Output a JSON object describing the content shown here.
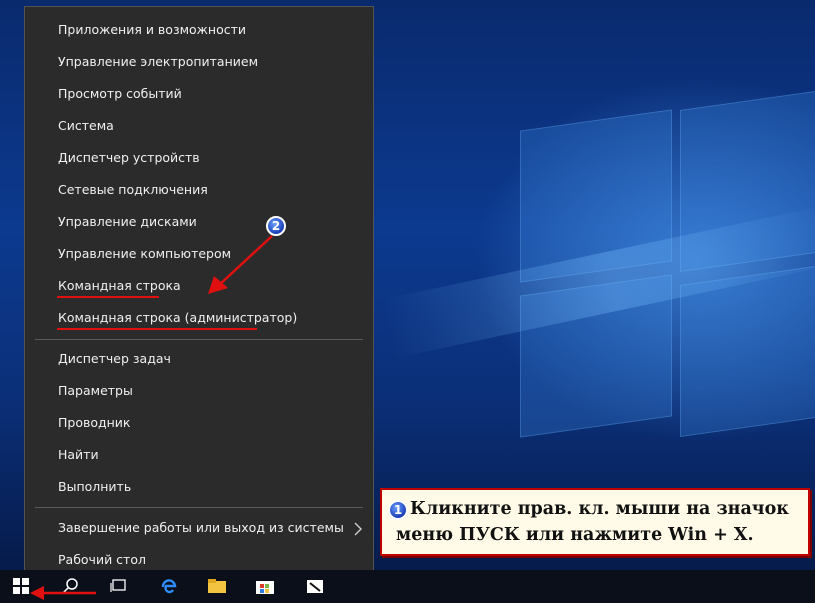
{
  "menu": {
    "items": [
      {
        "label": "Приложения и возможности"
      },
      {
        "label": "Управление электропитанием"
      },
      {
        "label": "Просмотр событий"
      },
      {
        "label": "Система"
      },
      {
        "label": "Диспетчер устройств"
      },
      {
        "label": "Сетевые подключения"
      },
      {
        "label": "Управление дисками"
      },
      {
        "label": "Управление компьютером"
      },
      {
        "label": "Командная строка"
      },
      {
        "label": "Командная строка (администратор)"
      },
      {
        "label": "Диспетчер задач"
      },
      {
        "label": "Параметры"
      },
      {
        "label": "Проводник"
      },
      {
        "label": "Найти"
      },
      {
        "label": "Выполнить"
      },
      {
        "label": "Завершение работы или выход из системы"
      },
      {
        "label": "Рабочий стол"
      }
    ],
    "submenu_icon": "chevron-right-icon"
  },
  "annotations": {
    "badge_1": "1",
    "badge_2": "2",
    "callout_line1": "Кликните прав. кл. мыши на значок",
    "callout_line2": "меню ПУСК или нажмите Win + X.",
    "accent_color": "#e01010"
  },
  "taskbar": {
    "icons": [
      "windows-start-icon",
      "search-icon",
      "task-view-icon",
      "edge-icon",
      "file-explorer-icon",
      "store-icon",
      "app-icon"
    ]
  }
}
